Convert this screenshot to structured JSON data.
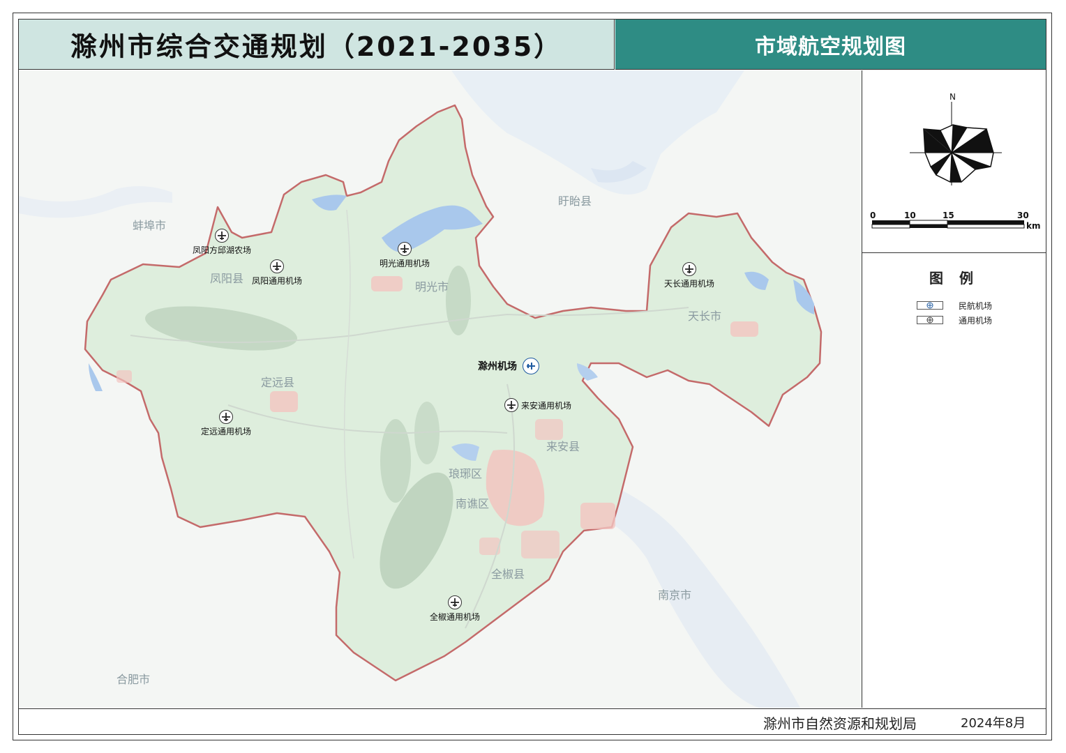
{
  "header": {
    "main_title": "滁州市综合交通规划（2021-2035）",
    "sub_title": "市域航空规划图"
  },
  "map": {
    "surrounding_places": {
      "bengbu": "蚌埠市",
      "xuyi": "盱眙县",
      "nanjing": "南京市",
      "hefei": "合肥市"
    },
    "counties": {
      "fengyang": "凤阳县",
      "mingguang": "明光市",
      "tianchang": "天长市",
      "dingyuan": "定远县",
      "laian": "来安县",
      "langya": "琅琊区",
      "nanqiao": "南谯区",
      "quanjiao": "全椒县"
    },
    "airports": {
      "chuzhou": "滁州机场",
      "fengyang_qiuhu": "凤阳方邱湖农场",
      "fengyang_general": "凤阳通用机场",
      "mingguang_general": "明光通用机场",
      "tianchang_general": "天长通用机场",
      "laian_general": "来安通用机场",
      "dingyuan_general": "定远通用机场",
      "quanjiao_general": "全椒通用机场"
    },
    "colors": {
      "city_fill": "#deeedd",
      "boundary": "#c46a6a",
      "water": "#a9c8ec",
      "urban": "#f2c4c0",
      "civil_airport": "#1e5aa0"
    }
  },
  "compass": {
    "north_label": "N"
  },
  "scale_bar": {
    "ticks": [
      "0",
      "10",
      "15",
      "30"
    ],
    "unit": "km"
  },
  "legend": {
    "title": "图 例",
    "items": [
      {
        "label": "民航机场",
        "icon": "civil-airport-icon"
      },
      {
        "label": "通用机场",
        "icon": "general-airport-icon"
      }
    ]
  },
  "footer": {
    "organization": "滁州市自然资源和规划局",
    "date": "2024年8月"
  }
}
